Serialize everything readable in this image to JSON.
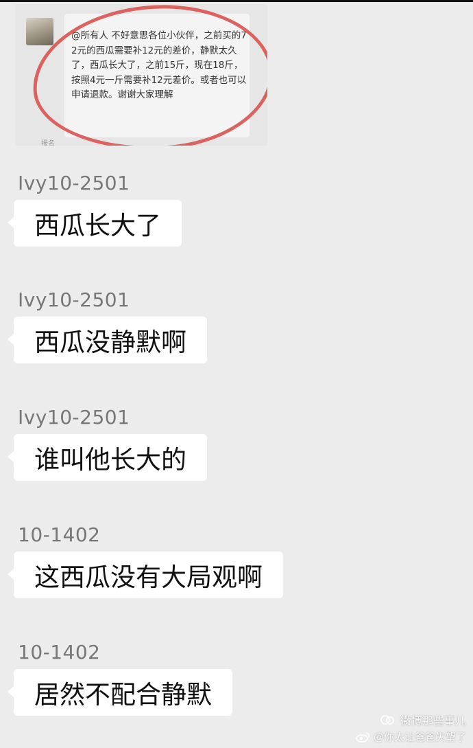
{
  "quoted_message": {
    "text": "@所有人 不好意思各位小伙伴，之前买的72元的西瓜需要补12元的差价，静默太久了，西瓜长大了，之前15斤，现在18斤，按照4元一斤需要补12元差价。或者也可以申请退款。谢谢大家理解",
    "cut_sender": "报名"
  },
  "messages": [
    {
      "sender": "Ivy10-2501",
      "text": "西瓜长大了"
    },
    {
      "sender": "Ivy10-2501",
      "text": "西瓜没静默啊"
    },
    {
      "sender": "Ivy10-2501",
      "text": "谁叫他长大的"
    },
    {
      "sender": "10-1402",
      "text": "这西瓜没有大局观啊"
    },
    {
      "sender": "10-1402",
      "text": "居然不配合静默"
    }
  ],
  "watermark": {
    "account": "微博那些事儿",
    "handle": "@你太让爸爸失望了"
  },
  "colors": {
    "background": "#ececec",
    "bubble": "#ffffff",
    "highlight_ring": "#d9534f"
  }
}
